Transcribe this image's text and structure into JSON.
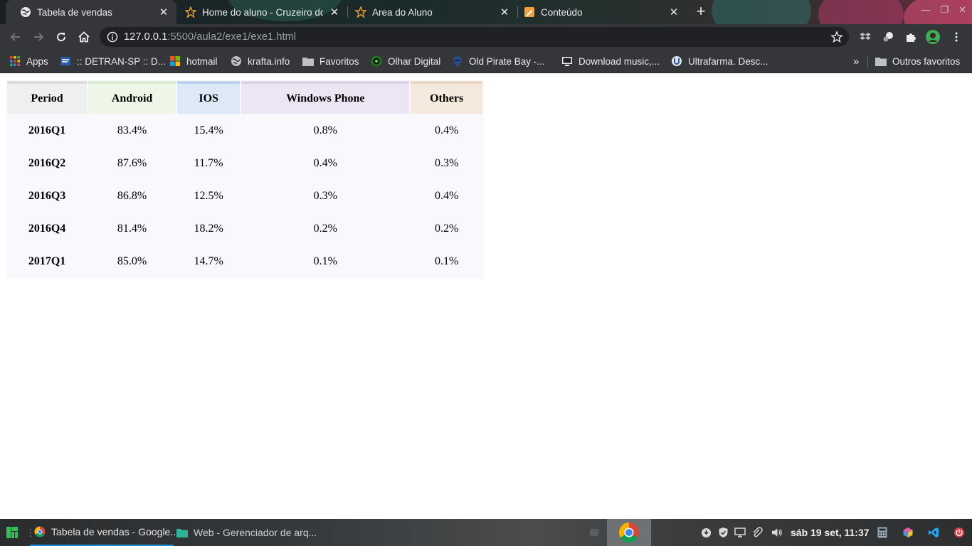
{
  "browser": {
    "tabs": [
      {
        "title": "Tabela de vendas",
        "icon": "globe-icon",
        "active": true
      },
      {
        "title": "Home do aluno - Cruzeiro do",
        "icon": "star-logo-icon",
        "active": false
      },
      {
        "title": "Area do Aluno",
        "icon": "star-logo-icon",
        "active": false
      },
      {
        "title": "Conteúdo",
        "icon": "pencil-doc-icon",
        "active": false
      }
    ],
    "new_tab": "+",
    "address": {
      "host": "127.0.0.1",
      "rest": ":5500/aula2/exe1/exe1.html"
    },
    "bookmarks": [
      {
        "label": "Apps",
        "icon": "apps-grid-icon"
      },
      {
        "label": ":: DETRAN-SP :: D...",
        "icon": "detran-icon"
      },
      {
        "label": "hotmail",
        "icon": "microsoft-logo-icon"
      },
      {
        "label": "krafta.info",
        "icon": "globe-icon"
      },
      {
        "label": "Favoritos",
        "icon": "folder-icon"
      },
      {
        "label": "Olhar Digital",
        "icon": "eye-logo-icon"
      },
      {
        "label": "Old Pirate Bay -...",
        "icon": "skull-icon"
      },
      {
        "label": "Download music,...",
        "icon": "monitor-icon"
      },
      {
        "label": "Ultrafarma. Desc...",
        "icon": "ultrafarma-icon"
      }
    ],
    "more_bookmarks": "»",
    "other_bookmarks": "Outros favoritos"
  },
  "table": {
    "headers": [
      "Period",
      "Android",
      "IOS",
      "Windows Phone",
      "Others"
    ],
    "rows": [
      [
        "2016Q1",
        "83.4%",
        "15.4%",
        "0.8%",
        "0.4%"
      ],
      [
        "2016Q2",
        "87.6%",
        "11.7%",
        "0.4%",
        "0.3%"
      ],
      [
        "2016Q3",
        "86.8%",
        "12.5%",
        "0.3%",
        "0.4%"
      ],
      [
        "2016Q4",
        "81.4%",
        "18.2%",
        "0.2%",
        "0.2%"
      ],
      [
        "2017Q1",
        "85.0%",
        "14.7%",
        "0.1%",
        "0.1%"
      ]
    ]
  },
  "taskbar": {
    "windows": [
      {
        "label": "Tabela de vendas - Google...",
        "icon": "chrome-icon",
        "active": true
      },
      {
        "label": "Web - Gerenciador de arq...",
        "icon": "folder-icon",
        "active": false
      }
    ],
    "clock": "sáb 19 set, 11:37"
  },
  "colors": {
    "chrome_dark": "#35363a",
    "omnibox": "#202124",
    "taskbar_accent": "#1a8fd8",
    "header_period": "#efefef",
    "header_android": "#eff6e8",
    "header_ios": "#dde9f6",
    "header_windows_phone": "#ece6f4",
    "header_others": "#f5e8dd"
  }
}
